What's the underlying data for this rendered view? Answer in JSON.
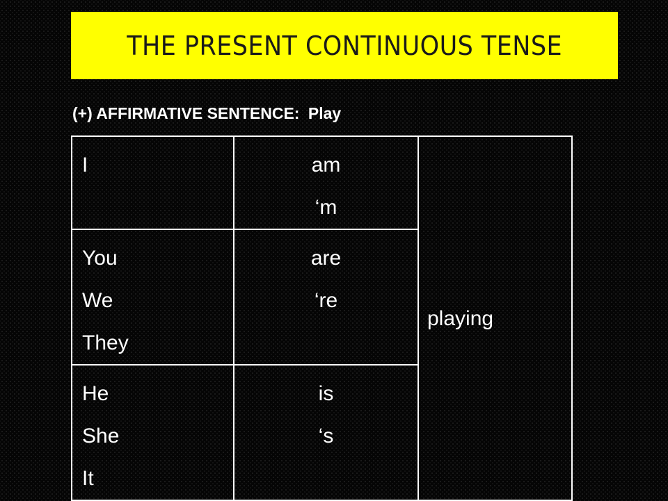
{
  "title": "THE PRESENT CONTINUOUS TENSE",
  "subtitle": {
    "label": "(+) AFFIRMATIVE SENTENCE:",
    "verb": "Play"
  },
  "table": {
    "main_verb": "playing",
    "rows": [
      {
        "subjects": [
          "I"
        ],
        "aux": [
          "am",
          "‘m"
        ]
      },
      {
        "subjects": [
          "You",
          "We",
          "They"
        ],
        "aux": [
          "are",
          "‘re"
        ]
      },
      {
        "subjects": [
          "He",
          "She",
          "It"
        ],
        "aux": [
          "is",
          "‘s"
        ]
      }
    ]
  },
  "colors": {
    "title_background": "#ffff00",
    "title_text": "#1a1a1a",
    "slide_background": "#050505",
    "text": "#ffffff"
  }
}
